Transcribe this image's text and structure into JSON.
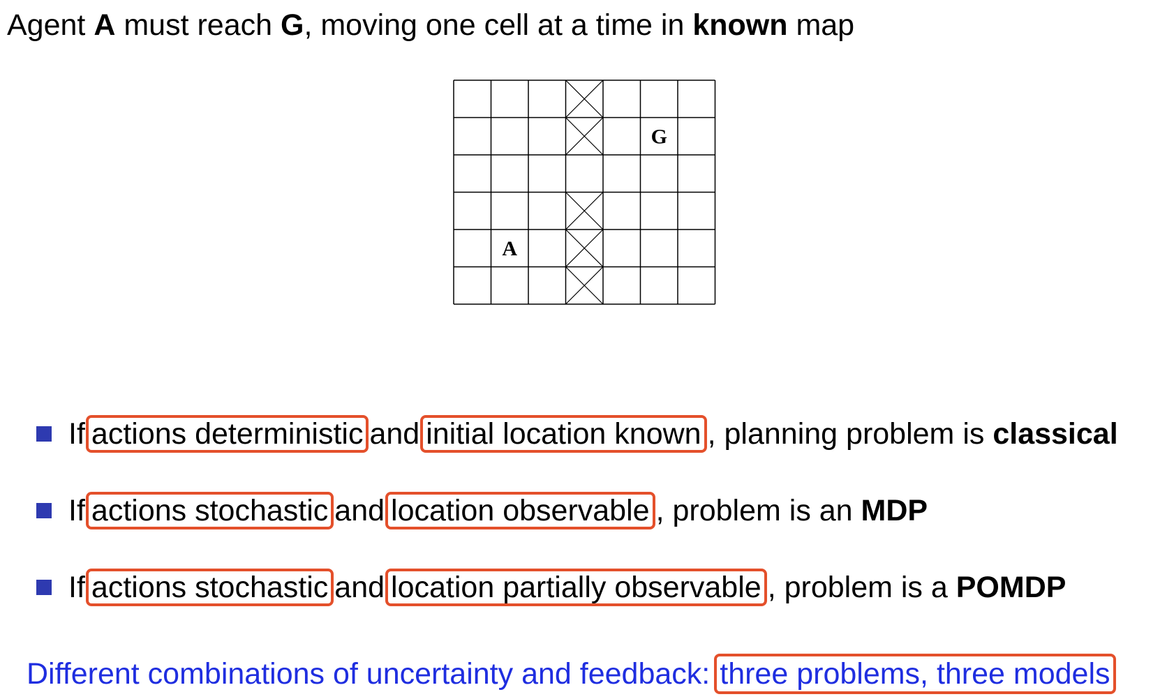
{
  "heading": {
    "t1": "Agent ",
    "agent": "A",
    "t2": " must reach ",
    "goal": "G",
    "t3": ", moving one cell at a time in ",
    "known": "known",
    "t4": " map"
  },
  "grid": {
    "rows": 6,
    "cols": 7,
    "blocked": [
      [
        0,
        3
      ],
      [
        1,
        3
      ],
      [
        3,
        3
      ],
      [
        4,
        3
      ],
      [
        5,
        3
      ]
    ],
    "agent": {
      "label": "A",
      "row": 4,
      "col": 1
    },
    "goal": {
      "label": "G",
      "row": 1,
      "col": 5
    }
  },
  "bullets": [
    {
      "if": "If",
      "cond1": "actions deterministic",
      "and": "and",
      "cond2": "initial location known",
      "rest": ", planning problem is ",
      "result": "classical"
    },
    {
      "if": "If",
      "cond1": "actions stochastic",
      "and": "and",
      "cond2": "location observable",
      "rest": ", problem is an ",
      "result": "MDP"
    },
    {
      "if": "If",
      "cond1": "actions stochastic",
      "and": "and",
      "cond2": "location partially observable",
      "rest": ", problem is a ",
      "result": "POMDP"
    }
  ],
  "summary": {
    "text": "Different combinations of uncertainty and feedback:",
    "highlight": "three problems, three models"
  },
  "colors": {
    "bullet": "#2e3ab0",
    "highlight_border": "#e4502b",
    "summary_text": "#1f2ee0"
  }
}
